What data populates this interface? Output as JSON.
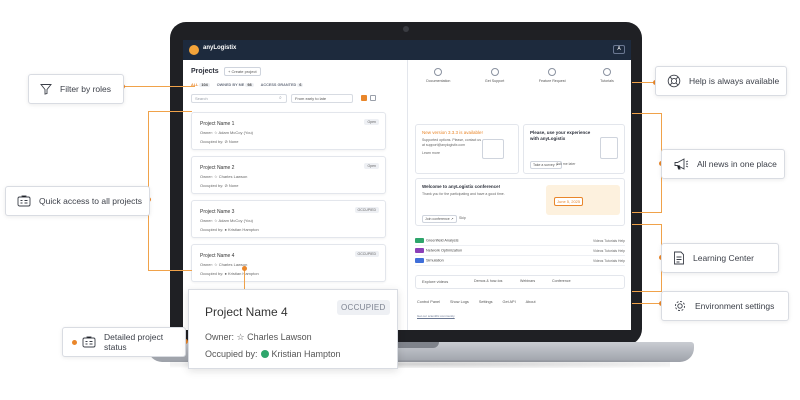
{
  "app": {
    "name": "anyLogistix",
    "user_menu": "A"
  },
  "projects": {
    "title": "Projects",
    "create_label": "+ Create project",
    "filters": [
      {
        "label": "ALL",
        "count": "104"
      },
      {
        "label": "OWNED BY ME",
        "count": "98"
      },
      {
        "label": "ACCESS GRANTED",
        "count": "6"
      }
    ],
    "search_placeholder": "Search",
    "sort_value": "From early to late",
    "cards": [
      {
        "name": "Project Name 1",
        "tag": "Open",
        "owner": "Owner:  ☆ Adam McCoy (You)",
        "occupied": "Occupied by:  ⊘ None"
      },
      {
        "name": "Project Name 2",
        "tag": "Open",
        "owner": "Owner:  ☆ Charles Lawson",
        "occupied": "Occupied by:  ⊘ None"
      },
      {
        "name": "Project Name 3",
        "tag": "OCCUPIED",
        "owner": "Owner:  ☆ Adam McCoy (You)",
        "occupied": "Occupied by:  ● Kristian Hampton"
      },
      {
        "name": "Project Name 4",
        "tag": "OCCUPIED",
        "owner": "Owner:  ☆ Charles Lawson",
        "occupied": "Occupied by:  ● Kristian Hampton"
      }
    ]
  },
  "right": {
    "quick_links": [
      "Documentation",
      "Get Support",
      "Feature Request",
      "Tutorials"
    ],
    "version_title": "New version 3.3.3 is available!",
    "version_text": "Supported options. Please, contact us at support@anylogistix.com",
    "version_link": "Learn more",
    "survey_title": "Please, use your experience with anyLogistix",
    "survey_btn": "Take a survey ↗",
    "survey_later": "Ask me later",
    "conf_title": "Welcome to anyLogistix conference!",
    "conf_text": "Thank you for the participating and have a good time.",
    "conf_btn": "Join conference ↗",
    "conf_skip": "Skip",
    "conf_date": "June 5, 2025",
    "apps": [
      {
        "chip": "GFA",
        "name": "Greenfield Analysis",
        "color": "#2ea56b"
      },
      {
        "chip": "NO",
        "name": "Network Optimization",
        "color": "#8b3fb8"
      },
      {
        "chip": "SIM",
        "name": "Simulation",
        "color": "#3f6fd9"
      }
    ],
    "app_links": "Videos   Tutorials   Help",
    "explore_label": "Explore videos",
    "explore_items": [
      "Demos & how-tos",
      "Webinars",
      "Conference"
    ],
    "settings": [
      "Control Panel",
      "Show Logs",
      "Settings",
      "Get API",
      "About"
    ],
    "tiny_link": "Get our scientific community"
  },
  "callouts": {
    "filter": "Filter by roles",
    "quick": "Quick access to all projects",
    "status": "Detailed project status",
    "help": "Help is always available",
    "news": "All news in one place",
    "learning": "Learning Center",
    "env": "Environment settings"
  },
  "zoom": {
    "name": "Project Name 4",
    "tag": "OCCUPIED",
    "owner_label": "Owner:",
    "owner": "Charles Lawson",
    "occupied_label": "Occupied by:",
    "occupied": "Kristian Hampton"
  },
  "colors": {
    "accent": "#e9862a",
    "navbar": "#1d2a3d",
    "occupied": "#2ea56b"
  }
}
